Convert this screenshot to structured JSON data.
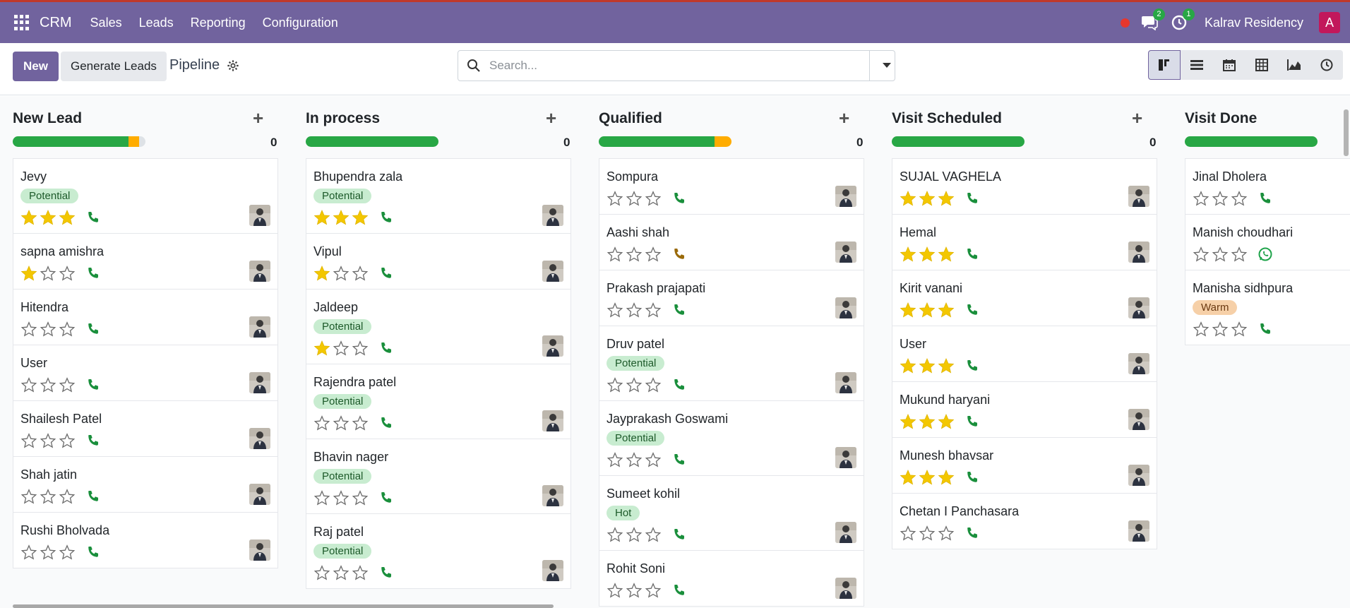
{
  "nav": {
    "brand": "CRM",
    "items": [
      "Sales",
      "Leads",
      "Reporting",
      "Configuration"
    ],
    "messages_badge": "2",
    "activities_badge": "1",
    "company": "Kalrav Residency",
    "user_initial": "A"
  },
  "toolbar": {
    "new_label": "New",
    "generate_label": "Generate Leads",
    "breadcrumb": "Pipeline",
    "search_placeholder": "Search..."
  },
  "colors": {
    "brand": "#71639e",
    "green": "#28a745",
    "orange": "#ffac00",
    "star": "#f3c700"
  },
  "columns": [
    {
      "title": "New Lead",
      "count": "0",
      "bar": {
        "green": 0.87,
        "orange": 0.08,
        "grey": 0.05
      },
      "cards": [
        {
          "name": "Jevy",
          "tag": "Potential",
          "stars": 3,
          "phone": "green"
        },
        {
          "name": "sapna amishra",
          "tag": "",
          "stars": 1,
          "phone": "green"
        },
        {
          "name": "Hitendra",
          "tag": "",
          "stars": 0,
          "phone": "green"
        },
        {
          "name": "User",
          "tag": "",
          "stars": 0,
          "phone": "green"
        },
        {
          "name": "Shailesh Patel",
          "tag": "",
          "stars": 0,
          "phone": "green"
        },
        {
          "name": "Shah jatin",
          "tag": "",
          "stars": 0,
          "phone": "green"
        },
        {
          "name": "Rushi Bholvada",
          "tag": "",
          "stars": 0,
          "phone": "green"
        }
      ]
    },
    {
      "title": "In process",
      "count": "0",
      "bar": {
        "green": 1.0,
        "orange": 0,
        "grey": 0
      },
      "cards": [
        {
          "name": "Bhupendra zala",
          "tag": "Potential",
          "stars": 3,
          "phone": "green"
        },
        {
          "name": "Vipul",
          "tag": "",
          "stars": 1,
          "phone": "green"
        },
        {
          "name": "Jaldeep",
          "tag": "Potential",
          "stars": 1,
          "phone": "green"
        },
        {
          "name": "Rajendra patel",
          "tag": "Potential",
          "stars": 0,
          "phone": "green"
        },
        {
          "name": "Bhavin nager",
          "tag": "Potential",
          "stars": 0,
          "phone": "green"
        },
        {
          "name": "Raj patel",
          "tag": "Potential",
          "stars": 0,
          "phone": "green"
        }
      ]
    },
    {
      "title": "Qualified",
      "count": "0",
      "bar": {
        "green": 0.87,
        "orange": 0.13,
        "grey": 0
      },
      "cards": [
        {
          "name": "Sompura",
          "tag": "",
          "stars": 0,
          "phone": "green"
        },
        {
          "name": "Aashi shah",
          "tag": "",
          "stars": 0,
          "phone": "orange"
        },
        {
          "name": "Prakash prajapati",
          "tag": "",
          "stars": 0,
          "phone": "green"
        },
        {
          "name": "Druv patel",
          "tag": "Potential",
          "stars": 0,
          "phone": "green"
        },
        {
          "name": "Jayprakash Goswami",
          "tag": "Potential",
          "stars": 0,
          "phone": "green"
        },
        {
          "name": "Sumeet kohil",
          "tag": "Hot",
          "stars": 0,
          "phone": "green"
        },
        {
          "name": "Rohit Soni",
          "tag": "",
          "stars": 0,
          "phone": "green"
        }
      ]
    },
    {
      "title": "Visit Scheduled",
      "count": "0",
      "bar": {
        "green": 1.0,
        "orange": 0,
        "grey": 0
      },
      "cards": [
        {
          "name": "SUJAL VAGHELA",
          "tag": "",
          "stars": 3,
          "phone": "green"
        },
        {
          "name": "Hemal",
          "tag": "",
          "stars": 3,
          "phone": "green"
        },
        {
          "name": "Kirit vanani",
          "tag": "",
          "stars": 3,
          "phone": "green"
        },
        {
          "name": "User",
          "tag": "",
          "stars": 3,
          "phone": "green"
        },
        {
          "name": "Mukund haryani",
          "tag": "",
          "stars": 3,
          "phone": "green"
        },
        {
          "name": "Munesh bhavsar",
          "tag": "",
          "stars": 3,
          "phone": "green"
        },
        {
          "name": "Chetan I Panchasara",
          "tag": "",
          "stars": 0,
          "phone": "green"
        }
      ]
    },
    {
      "title": "Visit Done",
      "count": "",
      "bar": {
        "green": 1.0,
        "orange": 0,
        "grey": 0
      },
      "cards": [
        {
          "name": "Jinal Dholera",
          "tag": "",
          "stars": 0,
          "phone": "green"
        },
        {
          "name": "Manish choudhari",
          "tag": "",
          "stars": 0,
          "phone": "whatsapp"
        },
        {
          "name": "Manisha sidhpura",
          "tag": "Warm",
          "stars": 0,
          "phone": "green"
        }
      ]
    }
  ]
}
